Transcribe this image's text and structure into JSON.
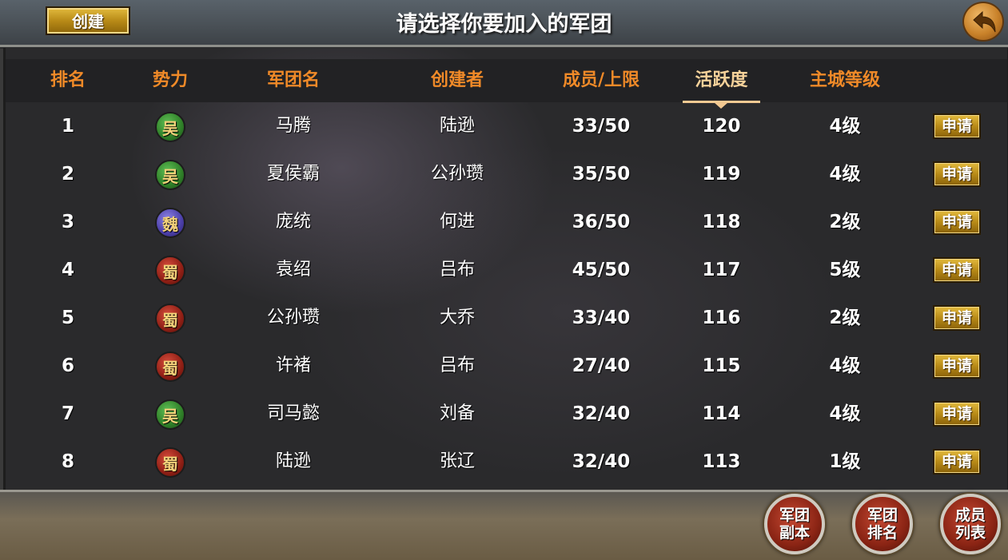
{
  "header": {
    "create_label": "创建",
    "title": "请选择你要加入的军团"
  },
  "columns": {
    "rank": "排名",
    "faction": "势力",
    "name": "军团名",
    "creator": "创建者",
    "members": "成员/上限",
    "activity": "活跃度",
    "city_level": "主城等级"
  },
  "rows": [
    {
      "rank": "1",
      "faction": "吴",
      "faction_type": "wu",
      "name": "马腾",
      "creator": "陆逊",
      "members": "33/50",
      "activity": "120",
      "level": "4级",
      "apply": "申请"
    },
    {
      "rank": "2",
      "faction": "吴",
      "faction_type": "wu",
      "name": "夏侯霸",
      "creator": "公孙瓒",
      "members": "35/50",
      "activity": "119",
      "level": "4级",
      "apply": "申请"
    },
    {
      "rank": "3",
      "faction": "魏",
      "faction_type": "wei",
      "name": "庞统",
      "creator": "何进",
      "members": "36/50",
      "activity": "118",
      "level": "2级",
      "apply": "申请"
    },
    {
      "rank": "4",
      "faction": "蜀",
      "faction_type": "shu",
      "name": "袁绍",
      "creator": "吕布",
      "members": "45/50",
      "activity": "117",
      "level": "5级",
      "apply": "申请"
    },
    {
      "rank": "5",
      "faction": "蜀",
      "faction_type": "shu",
      "name": "公孙瓒",
      "creator": "大乔",
      "members": "33/40",
      "activity": "116",
      "level": "2级",
      "apply": "申请"
    },
    {
      "rank": "6",
      "faction": "蜀",
      "faction_type": "shu",
      "name": "许褚",
      "creator": "吕布",
      "members": "27/40",
      "activity": "115",
      "level": "4级",
      "apply": "申请"
    },
    {
      "rank": "7",
      "faction": "吴",
      "faction_type": "wu",
      "name": "司马懿",
      "creator": "刘备",
      "members": "32/40",
      "activity": "114",
      "level": "4级",
      "apply": "申请"
    },
    {
      "rank": "8",
      "faction": "蜀",
      "faction_type": "shu",
      "name": "陆逊",
      "creator": "张辽",
      "members": "32/40",
      "activity": "113",
      "level": "1级",
      "apply": "申请"
    }
  ],
  "bottom_buttons": [
    {
      "line1": "军团",
      "line2": "副本"
    },
    {
      "line1": "军团",
      "line2": "排名"
    },
    {
      "line1": "成员",
      "line2": "列表"
    }
  ],
  "icons": {
    "back": "back-arrow-icon"
  },
  "colors": {
    "header_text": "#f08a28",
    "active_header": "#f7d29a",
    "button_gold": "#b88a17"
  }
}
